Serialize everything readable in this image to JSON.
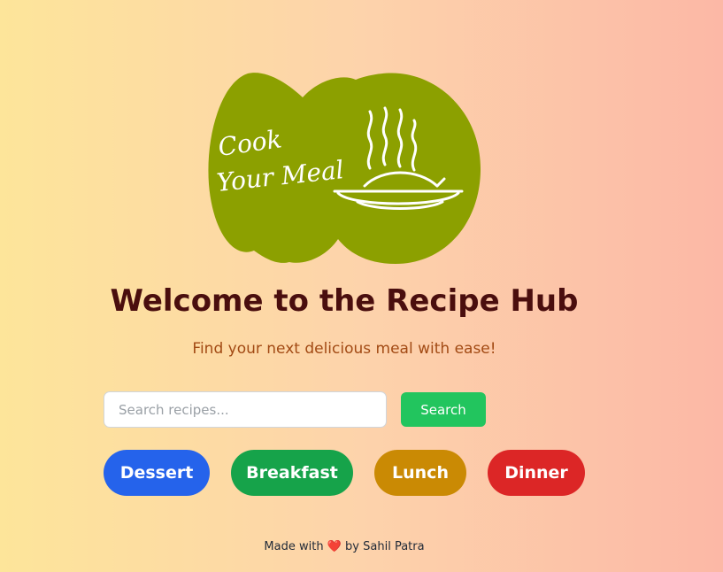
{
  "logo": {
    "line1": "Cook",
    "line2": "Your Meal",
    "icon": "steaming-plate-icon",
    "color": "#8ca000"
  },
  "header": {
    "title": "Welcome to the Recipe Hub",
    "subtitle": "Find your next delicious meal with ease!"
  },
  "search": {
    "placeholder": "Search recipes...",
    "value": "",
    "button_label": "Search"
  },
  "categories": [
    {
      "label": "Dessert",
      "color": "#2563eb"
    },
    {
      "label": "Breakfast",
      "color": "#16a34a"
    },
    {
      "label": "Lunch",
      "color": "#ca8a04"
    },
    {
      "label": "Dinner",
      "color": "#dc2626"
    }
  ],
  "footer": {
    "prefix": "Made with",
    "heart": "❤️",
    "suffix": "by Sahil Patra"
  }
}
